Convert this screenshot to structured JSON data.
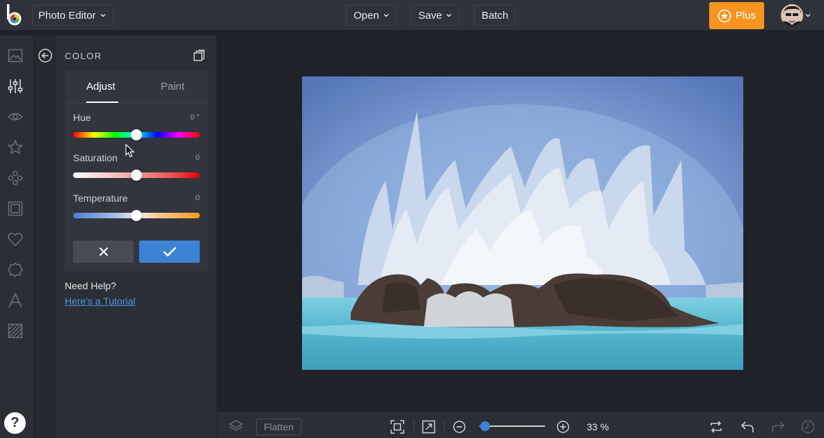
{
  "header": {
    "app_menu_label": "Photo Editor",
    "open_label": "Open",
    "save_label": "Save",
    "batch_label": "Batch",
    "plus_label": "Plus"
  },
  "rail": {
    "icons": [
      "image-icon",
      "sliders-icon",
      "eye-icon",
      "star-icon",
      "overlays-icon",
      "frame-icon",
      "heart-icon",
      "texture-icon",
      "text-icon",
      "hatch-icon"
    ],
    "active": "sliders-icon",
    "help_label": "?"
  },
  "panel": {
    "title": "COLOR",
    "tabs": [
      {
        "label": "Adjust",
        "active": true
      },
      {
        "label": "Paint",
        "active": false
      }
    ],
    "sliders": [
      {
        "label": "Hue",
        "value": "0 °",
        "level": 0.5
      },
      {
        "label": "Saturation",
        "value": "0",
        "level": 0.5
      },
      {
        "label": "Temperature",
        "value": "0",
        "level": 0.5
      }
    ],
    "help_heading": "Need Help?",
    "help_link": "Here's a Tutorial"
  },
  "bottom": {
    "flatten_label": "Flatten",
    "zoom_value": "33 %",
    "zoom_level": 0.09
  },
  "colors": {
    "accent": "#3d83d4",
    "plus": "#f7931e",
    "topbar": "#2f323a",
    "panel": "#2b2e35",
    "canvas": "#1f2229"
  }
}
